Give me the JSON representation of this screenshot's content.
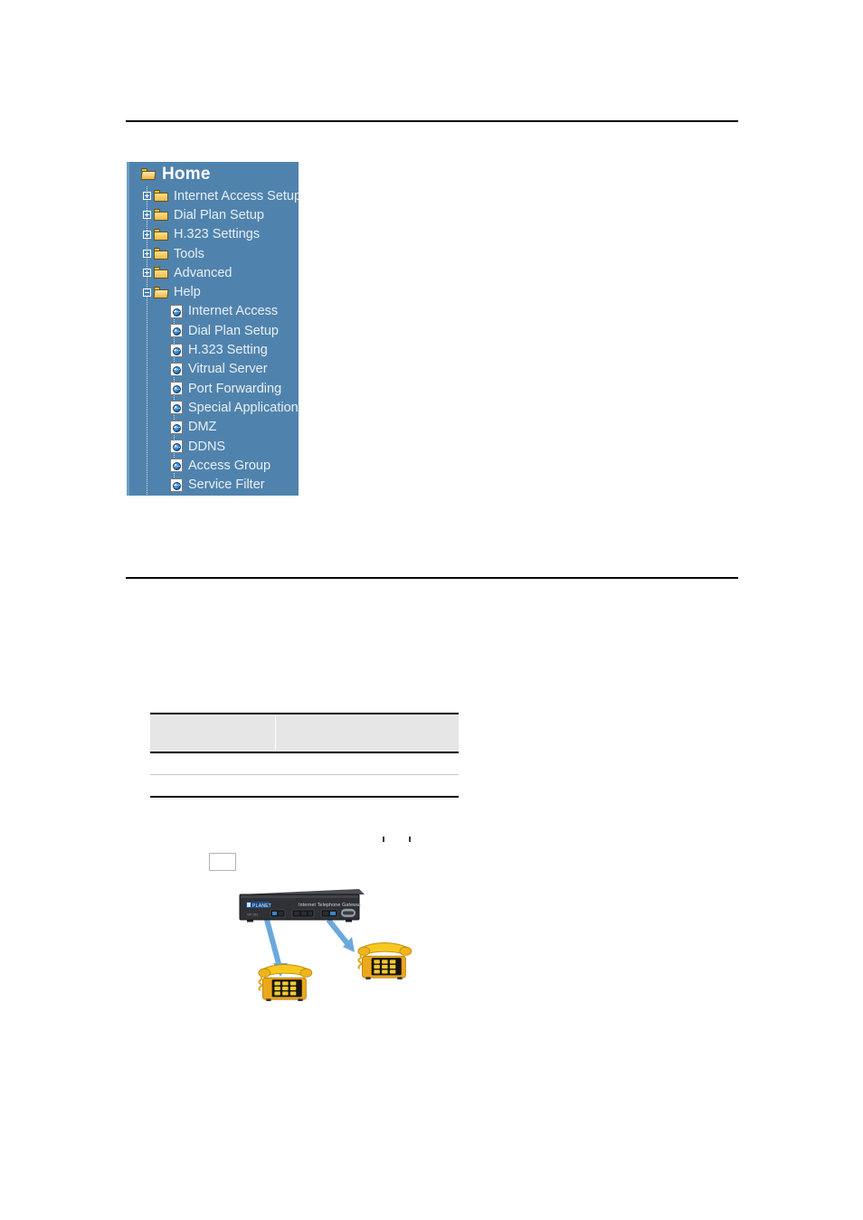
{
  "rules": {
    "top": "",
    "bottom": ""
  },
  "nav_tree": {
    "root": {
      "label": "Home",
      "icon": "open-folder-icon",
      "expanded": true
    },
    "items": [
      {
        "label": "Internet Access Setup",
        "icon": "folder-icon",
        "expander": "plus",
        "level": 1
      },
      {
        "label": "Dial Plan Setup",
        "icon": "folder-icon",
        "expander": "plus",
        "level": 1
      },
      {
        "label": "H.323 Settings",
        "icon": "folder-icon",
        "expander": "plus",
        "level": 1
      },
      {
        "label": "Tools",
        "icon": "folder-icon",
        "expander": "plus",
        "level": 1
      },
      {
        "label": "Advanced",
        "icon": "folder-icon",
        "expander": "plus",
        "level": 1
      },
      {
        "label": "Help",
        "icon": "open-folder-icon",
        "expander": "minus",
        "level": 1
      },
      {
        "label": "Internet Access",
        "icon": "web-page-icon",
        "expander": "none",
        "level": 2
      },
      {
        "label": "Dial Plan Setup",
        "icon": "web-page-icon",
        "expander": "none",
        "level": 2
      },
      {
        "label": "H.323 Setting",
        "icon": "web-page-icon",
        "expander": "none",
        "level": 2
      },
      {
        "label": "Vitrual Server",
        "icon": "web-page-icon",
        "expander": "none",
        "level": 2
      },
      {
        "label": "Port Forwarding",
        "icon": "web-page-icon",
        "expander": "none",
        "level": 2
      },
      {
        "label": "Special Application",
        "icon": "web-page-icon",
        "expander": "none",
        "level": 2
      },
      {
        "label": "DMZ",
        "icon": "web-page-icon",
        "expander": "none",
        "level": 2
      },
      {
        "label": "DDNS",
        "icon": "web-page-icon",
        "expander": "none",
        "level": 2
      },
      {
        "label": "Access Group",
        "icon": "web-page-icon",
        "expander": "none",
        "level": 2
      },
      {
        "label": "Service Filter",
        "icon": "web-page-icon",
        "expander": "none",
        "level": 2
      }
    ],
    "colors": {
      "panel_background": "#4f83ad",
      "panel_edge": "#6f9cc0",
      "label_text": "#e9eef3",
      "root_text": "#ffffff"
    }
  },
  "data_table": {
    "header": {
      "col1": "",
      "col2": ""
    },
    "rows": [
      {
        "col1": "",
        "col2": ""
      },
      {
        "col1": "",
        "col2": ""
      }
    ],
    "colors": {
      "header_background": "#e6e6e6",
      "border": "#000000",
      "row_divider": "#c8c8c8"
    }
  },
  "note_box": {
    "value": ""
  },
  "tick_marks": {
    "left": "",
    "right": ""
  },
  "diagram": {
    "gateway": {
      "brand": "PLANET",
      "model_text": "Internet Telephone Gateway",
      "body_color": "#3a3c3f",
      "face_color": "#2b2d30"
    },
    "phones": [
      {
        "name": "telephone-left",
        "color": "#f2bd1f"
      },
      {
        "name": "telephone-right",
        "color": "#f2bd1f"
      }
    ],
    "arrows": [
      {
        "name": "arrow-to-left-phone",
        "color": "#6aa8dc"
      },
      {
        "name": "arrow-to-right-phone",
        "color": "#6aa8dc"
      }
    ]
  }
}
